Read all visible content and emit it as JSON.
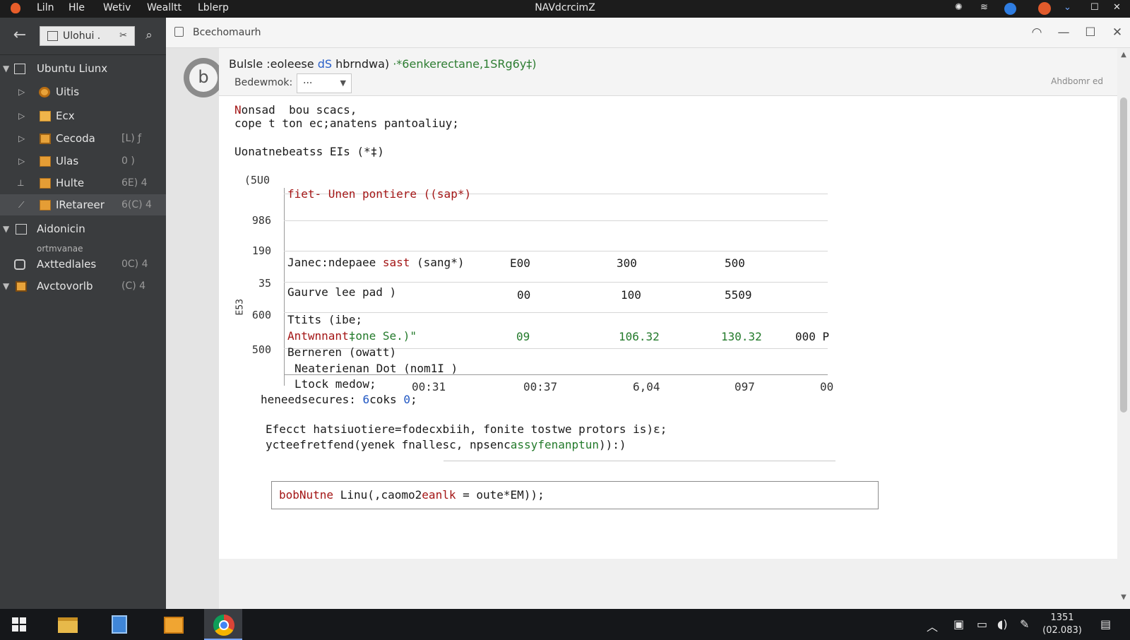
{
  "menubar": {
    "items": [
      "Liln",
      "Hle",
      "Wetiv",
      "Wealltt",
      "Lblerp"
    ],
    "title": "NAVdcrcimZ",
    "colors": {
      "bar": "#1c1c1c",
      "badge_blue": "#2f7de1",
      "badge_orange": "#e05a2b"
    }
  },
  "sidebar": {
    "search_value": "Ulohui .",
    "items": [
      {
        "label": "Ubuntu Liunx",
        "meta": "",
        "icon": "grid-icon"
      },
      {
        "label": "Uitis",
        "meta": "",
        "icon": "gear-icon"
      },
      {
        "label": "Ecx",
        "meta": "",
        "icon": "folder-icon"
      },
      {
        "label": "Cecoda",
        "meta": "[L) ƒ",
        "icon": "code-file-icon"
      },
      {
        "label": "Ulas",
        "meta": "0 )",
        "icon": "note-icon"
      },
      {
        "label": "Hulte",
        "meta": "6E) 4",
        "icon": "note-icon"
      },
      {
        "label": "IRetareer",
        "meta": "6(C) 4",
        "icon": "note-icon"
      },
      {
        "label": "Aidonicin",
        "meta": "",
        "icon": "box-icon"
      },
      {
        "label": "Axttedlales",
        "meta": "0C) 4",
        "icon": "ring-icon",
        "note": "ortmvanae"
      },
      {
        "label": "Avctovorlb",
        "meta": "(C) 4",
        "icon": "orange-box-icon"
      }
    ]
  },
  "window": {
    "tab_label": "Bcechomaurh"
  },
  "content": {
    "avatar_letter": "b",
    "headline": {
      "part1": "Bulsle :eoleese ",
      "part2": "dS",
      "part3": " hbrndwa) ",
      "part4": "·*6enkerectane,1SRg6y‡)"
    },
    "branch_label": "Bedewmok:",
    "branch_value": "···",
    "right_note": "Ahdbomr ed",
    "code_lines": {
      "l1a": "N",
      "l1b": "onsad  bou scacs,",
      "l2": "cope t ton ec;anatens pantoaliuy;",
      "l3": "Uonatnebeatss EIs (*‡)",
      "plot_title_a": "fiet- ",
      "plot_title_b": "Unen pontiere ((sap*)",
      "row1_a": "Janec:ndepaee ",
      "row1_b": "sast",
      "row1_c": " (sang*)",
      "row2": "Gaurve lee pad )",
      "row3": "Ttits (ibe;",
      "row4_a": "Antwnnant",
      "row4_b": "‡one Se.)\"",
      "row5": "Berneren (owatt)",
      "row6": "Neaterienan Dot (nom1I )",
      "row7": "Ltock medow;",
      "row8_a": "heneedsecures: ",
      "row8_b": "6",
      "row8_c": "coks ",
      "row8_d": "0",
      "row8_e": ";",
      "tail1": "Efecct hatsiuotiere=fodecxbiih, fonite tostwe protors is)ε;",
      "tail2_a": "ycteefretfend(yenek fnallesc, npsenc",
      "tail2_b": "assyfenanptun",
      "tail2_c": ")):)"
    },
    "plot": {
      "ylabel": "E53",
      "yticks": [
        "(5U0",
        "986",
        "190",
        "35",
        "600",
        "500"
      ],
      "col_r1": [
        "E00",
        "300",
        "500"
      ],
      "col_r2": [
        "00",
        "100",
        "5509"
      ],
      "col_r4": [
        "09",
        "106.32",
        "130.32",
        "000 P"
      ],
      "xticks": [
        "00:31",
        "00:37",
        "6,04",
        "097",
        "00"
      ]
    },
    "input": {
      "part1": "bobNutne",
      "part2": " Linu(,caomo2",
      "part3": "eanlk",
      "part4": " = oute*EM));"
    }
  },
  "taskbar": {
    "clock_time": "1351",
    "clock_date": "(02.083)"
  }
}
